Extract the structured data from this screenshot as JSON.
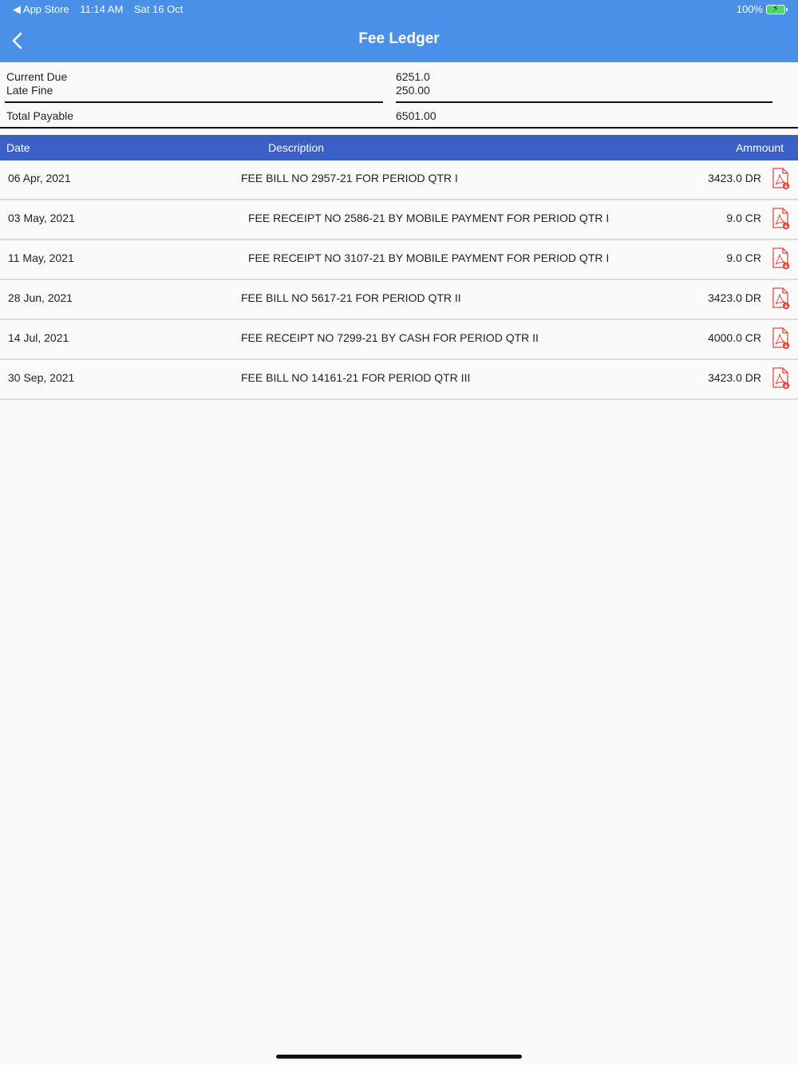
{
  "status_bar": {
    "back_app": "◀ App Store",
    "time": "11:14 AM",
    "date": "Sat 16 Oct",
    "battery": "100%"
  },
  "nav": {
    "title": "Fee Ledger"
  },
  "summary": {
    "current_due_label": "Current Due",
    "current_due_value": "6251.0",
    "late_fine_label": "Late Fine",
    "late_fine_value": "250.00",
    "total_payable_label": "Total Payable",
    "total_payable_value": "6501.00"
  },
  "table": {
    "headers": {
      "date": "Date",
      "description": "Description",
      "amount": "Ammount"
    },
    "rows": [
      {
        "date": "06 Apr, 2021",
        "description": "FEE BILL NO 2957-21 FOR PERIOD QTR I",
        "amount": "3423.0 DR"
      },
      {
        "date": "03 May, 2021",
        "description": "FEE RECEIPT NO 2586-21 BY MOBILE PAYMENT FOR PERIOD QTR I",
        "amount": "9.0 CR"
      },
      {
        "date": "11 May, 2021",
        "description": "FEE RECEIPT NO 3107-21 BY MOBILE PAYMENT FOR PERIOD QTR I",
        "amount": "9.0 CR"
      },
      {
        "date": "28 Jun, 2021",
        "description": "FEE BILL NO 5617-21 FOR PERIOD QTR II",
        "amount": "3423.0 DR"
      },
      {
        "date": "14 Jul, 2021",
        "description": "FEE RECEIPT NO 7299-21 BY CASH FOR PERIOD QTR II",
        "amount": "4000.0 CR"
      },
      {
        "date": "30 Sep, 2021",
        "description": "FEE BILL NO 14161-21 FOR PERIOD QTR III",
        "amount": "3423.0 DR"
      }
    ]
  },
  "colors": {
    "nav_bar": "#4a90e8",
    "table_header": "#3b5fc5",
    "pdf_icon": "#e8453c"
  },
  "icons": {
    "back": "chevron-left-icon",
    "row_action": "pdf-download-icon"
  }
}
